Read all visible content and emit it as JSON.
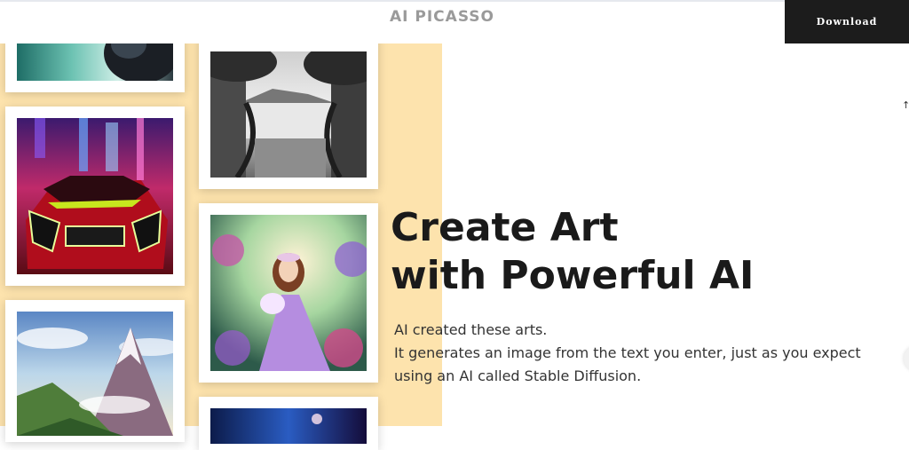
{
  "header": {
    "logo": "AI PICASSO",
    "download_label": "Download"
  },
  "hero": {
    "headline_line1": "Create Art",
    "headline_line2": "with Powerful AI",
    "desc_line1": "AI created these arts.",
    "desc_line2": "It generates an image from the text you enter, just as you expect",
    "desc_line3": "using an AI called Stable Diffusion."
  },
  "gallery": {
    "images": [
      "teal abstract artwork",
      "futuristic red car in neon city",
      "snowy mountain landscape",
      "pencil sketch of trees and lake",
      "fairy princess in flower garden",
      "night city scene"
    ]
  },
  "icons": {
    "scroll_top": "up-arrow-icon"
  },
  "colors": {
    "accent_panel": "#fde3ad",
    "download_bg": "#1c1c1c",
    "logo": "#9a9a9a",
    "headline": "#1a1a1a"
  }
}
